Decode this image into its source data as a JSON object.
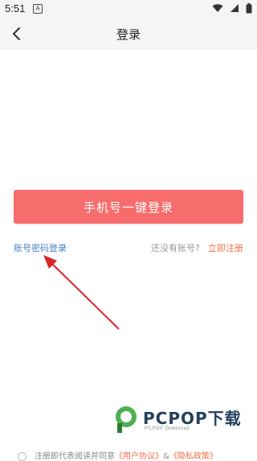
{
  "status_bar": {
    "time": "5:51",
    "notification_glyph": "A",
    "icons": [
      "wifi-icon",
      "signal-icon",
      "battery-icon"
    ]
  },
  "nav": {
    "title": "登录",
    "back_icon": "chevron-left-icon"
  },
  "login": {
    "one_click_button": "手机号一键登录",
    "password_login_link": "账号密码登录",
    "no_account_text": "还没有账号?",
    "register_link": "立即注册"
  },
  "agreement": {
    "prefix": "注册即代表阅读并同意",
    "user_agreement": "《用户协议》",
    "separator": "&",
    "privacy_policy": "《隐私政策》"
  },
  "watermark": {
    "brand": "PCPOP下载",
    "sub": "PCPOP Download"
  },
  "colors": {
    "accent_button": "#f76c6c",
    "link_blue": "#4a7fc1",
    "link_orange": "#f0704a",
    "annotation_arrow": "#d9262a"
  }
}
